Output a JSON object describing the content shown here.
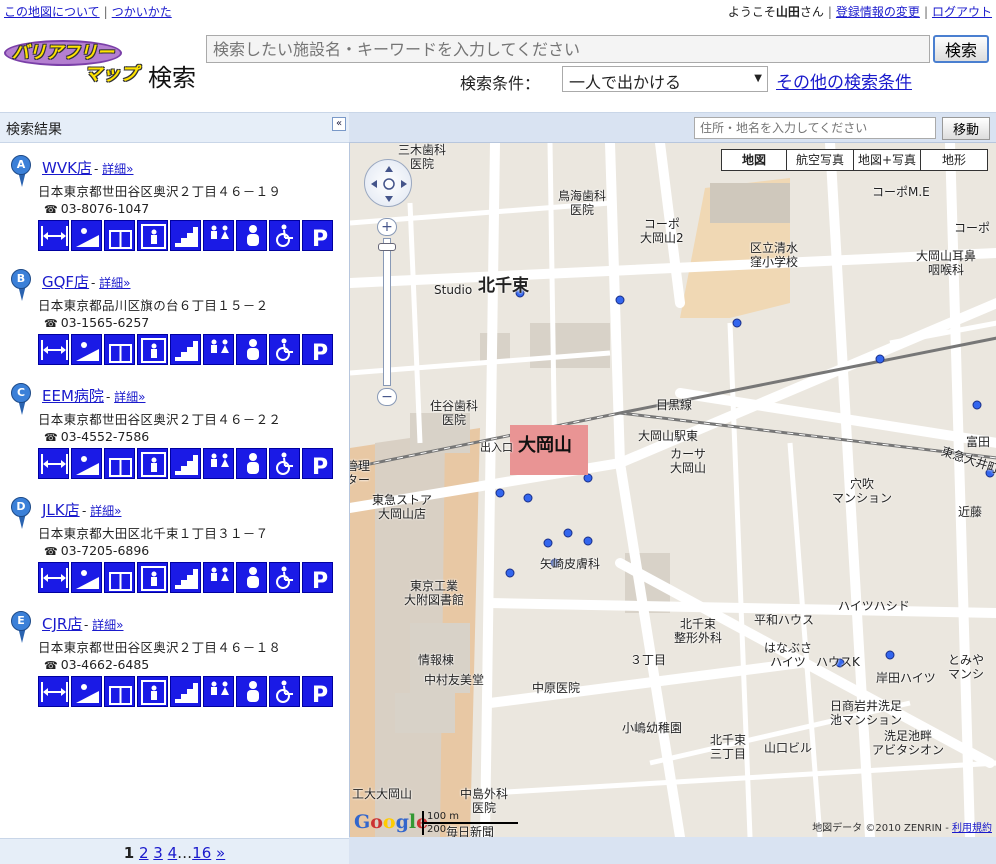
{
  "topbar": {
    "about": "この地図について",
    "howto": "つかいかた",
    "welcome_prefix": "ようこそ",
    "user": "山田",
    "welcome_suffix": "さん",
    "profile": "登録情報の変更",
    "logout": "ログアウト"
  },
  "logo": {
    "line1": "バリアフリー",
    "line2": "マップ",
    "line3": "検索"
  },
  "search": {
    "placeholder": "検索したい施設名・キーワードを入力してください",
    "button": "検索",
    "condition_label": "検索条件：",
    "condition_value": "一人で出かける",
    "more_conditions": "その他の検索条件"
  },
  "results_panel": {
    "title": "検索結果",
    "collapse": "«",
    "detail_label": "詳細»",
    "items": [
      {
        "marker": "A",
        "name": "WVK店",
        "address": "日本東京都世田谷区奥沢２丁目４６－１９",
        "tel": "03-8076-1047"
      },
      {
        "marker": "B",
        "name": "GQF店",
        "address": "日本東京都品川区旗の台６丁目１５－２",
        "tel": "03-1565-6257"
      },
      {
        "marker": "C",
        "name": "EEM病院",
        "address": "日本東京都世田谷区奥沢２丁目４６－２２",
        "tel": "03-4552-7586"
      },
      {
        "marker": "D",
        "name": "JLK店",
        "address": "日本東京都大田区北千束１丁目３１－７",
        "tel": "03-7205-6896"
      },
      {
        "marker": "E",
        "name": "CJR店",
        "address": "日本東京都世田谷区奥沢２丁目４６－１８",
        "tel": "03-4662-6485"
      }
    ],
    "facility_icons": [
      "width-icon",
      "ramp-icon",
      "entrance-icon",
      "elevator-icon",
      "stairs-icon",
      "toilet-icon",
      "baby-icon",
      "wheelchair-icon",
      "parking-icon"
    ],
    "facility_labels": {
      "entrance": "入口",
      "toilet": "トイレ",
      "parking": "P"
    }
  },
  "pager": {
    "current": "1",
    "pages": [
      "2",
      "3",
      "4"
    ],
    "ellipsis": "…",
    "last": "16",
    "next": "»"
  },
  "map": {
    "address_placeholder": "住所・地名を入力してください",
    "move_button": "移動",
    "map_types": [
      "地図",
      "航空写真",
      "地図+写真",
      "地形"
    ],
    "active_type": "地図",
    "copyright": "地図データ ©2010 ZENRIN - ",
    "terms": "利用規約",
    "scale_m": "100 m",
    "scale_ft": "200",
    "google": "Google",
    "labels": {
      "station": "大岡山",
      "kitasenzoku": "北千束",
      "studio": "Studio",
      "meguro_line": "目黒線",
      "oimachi_line": "東急大井町線",
      "ookayama_east": "大岡山駅東",
      "exit": "出入口",
      "tokyu_store": "東急ストア\n大岡山店",
      "titech_library": "東京工業\n大附図書館",
      "johoto": "情報棟",
      "nakamura": "中村友美堂",
      "nakahara": "中原医院",
      "kojima": "小嶋幼稚園",
      "kitasenzoku3": "北千束\n三丁目",
      "yamaguchi": "山口ビル",
      "nikoku": "日商岩井洗足\n池マンション",
      "senzoku": "洗足池畔\nアビタシオン",
      "kishita": "岸田ハイツ",
      "hanausagi": "はなぶさ\nハイツ",
      "houseK": "ハウスK",
      "heiwa": "平和ハウス",
      "haitsu": "ハイツハシド",
      "kitasenzoku_seikei": "北千束\n整形外科",
      "yazaki": "矢崎皮膚科",
      "ketsuana": "穴吹\nマンション",
      "karsa": "カーサ\n大岡山",
      "sumiya": "住谷歯科\n医院",
      "torimi": "鳥海歯科\n医院",
      "corpo2": "コーポ\n大岡山2",
      "corpoME": "コーポM.E",
      "corpo": "コーポ",
      "school": "区立清水\n窪小学校",
      "jibika": "大岡山耳鼻\n咽喉科",
      "kondo": "近藤",
      "tomiya": "とみや\nマンシ",
      "tomita": "富田",
      "sanki": "三木歯科\n医院",
      "sanchome": "３丁目",
      "nakashima": "中島外科\n医院",
      "mainichi": "毎日新聞",
      "ookayama_univ": "工大大岡山",
      "kanri": "管理\nター"
    }
  }
}
